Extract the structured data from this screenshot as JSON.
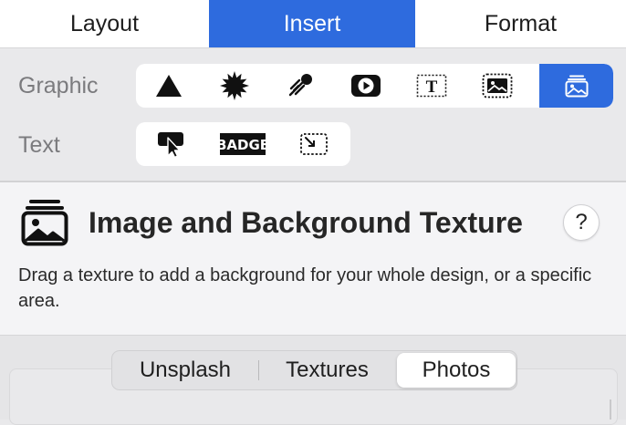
{
  "tabs": [
    {
      "label": "Layout",
      "active": false
    },
    {
      "label": "Insert",
      "active": true
    },
    {
      "label": "Format",
      "active": false
    }
  ],
  "rows": {
    "graphic_label": "Graphic",
    "text_label": "Text",
    "graphic_tools": [
      "triangle-shape-icon",
      "starburst-icon",
      "shooting-star-icon",
      "video-play-icon",
      "text-box-icon",
      "image-frame-icon",
      "image-texture-icon"
    ],
    "text_tools": [
      "callout-cursor-icon",
      "badge-icon",
      "resize-box-icon"
    ],
    "badge_text": "BADGE",
    "text_box_letter": "T"
  },
  "panel": {
    "title": "Image and Background Texture",
    "help": "?",
    "description": "Drag a texture to add a background for your whole design, or a specific area."
  },
  "segments": [
    {
      "label": "Unsplash",
      "selected": false
    },
    {
      "label": "Textures",
      "selected": false
    },
    {
      "label": "Photos",
      "selected": true
    }
  ],
  "colors": {
    "accent": "#2e6bde",
    "background": "#e9e9eb",
    "panel": "#f4f4f6"
  }
}
